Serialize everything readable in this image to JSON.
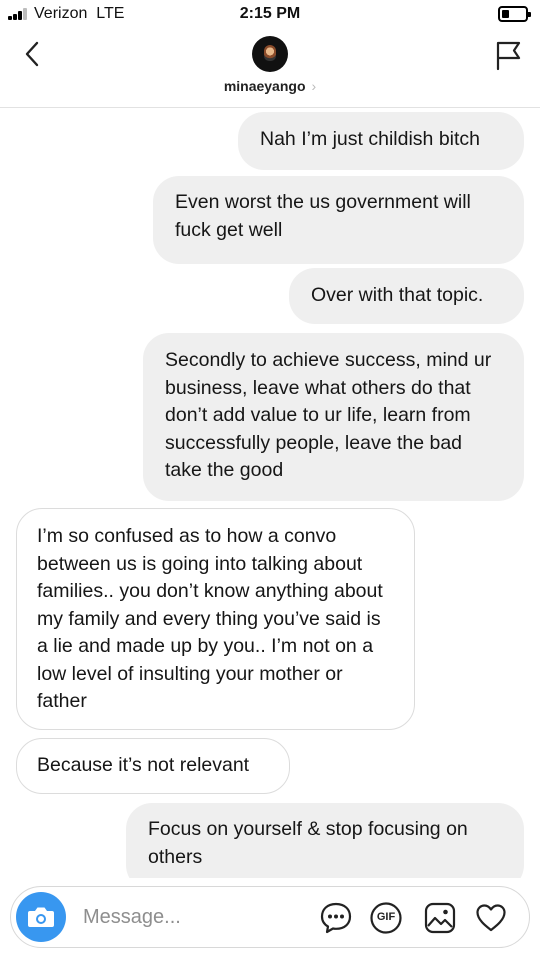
{
  "status_bar": {
    "carrier": "Verizon",
    "network": "LTE",
    "time": "2:15 PM",
    "battery_level": 0.3
  },
  "header": {
    "username": "minaeyango",
    "chevron": "›",
    "back_icon": "chevron-left-icon",
    "report_icon": "flag-icon"
  },
  "messages": [
    {
      "direction": "out",
      "text": "Nah I’m just childish bitch"
    },
    {
      "direction": "out",
      "text": "Even worst the us government will fuck get well"
    },
    {
      "direction": "out",
      "text": "Over with that topic."
    },
    {
      "direction": "out",
      "text": "Secondly to achieve success, mind ur business, leave what others do that don’t add value to ur life, learn from successfully people, leave the bad take the good"
    },
    {
      "direction": "in",
      "text": "I’m so confused as to how a convo between us is going into talking about families.. you don’t know anything about my family and every thing you’ve said is a lie and made up by you.. I’m not on a low level of insulting your mother or father"
    },
    {
      "direction": "in",
      "text": "Because it’s not relevant"
    },
    {
      "direction": "out",
      "text": "Focus on yourself & stop focusing on others"
    }
  ],
  "composer": {
    "placeholder": "Message...",
    "gif_label": "GIF",
    "camera_icon": "camera-icon",
    "tools": [
      "sticker-icon",
      "gif-icon",
      "gallery-icon",
      "heart-icon"
    ]
  },
  "colors": {
    "accent": "#3897f0",
    "outgoing_bubble": "#efefef",
    "incoming_border": "#dcdcdc",
    "placeholder": "#8e8e8e"
  }
}
